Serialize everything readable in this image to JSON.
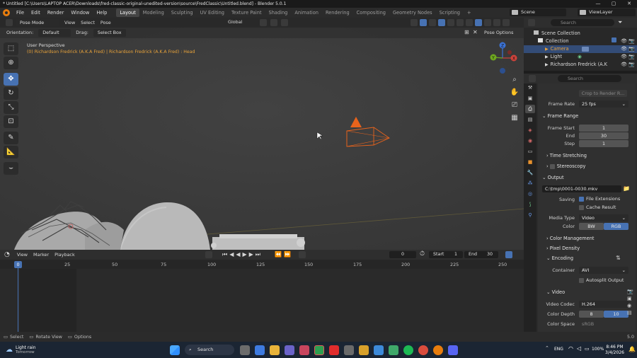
{
  "window": {
    "title": "* Untitled [C:\\Users\\LAPTOP ACER\\Downloads\\fred-classic-original-unedited-version\\source\\FredClassic\\Untitled.blend] - Blender 5.0.1",
    "controls": [
      "—",
      "▢",
      "✕"
    ]
  },
  "menu": [
    "File",
    "Edit",
    "Render",
    "Window",
    "Help"
  ],
  "workspaces": [
    "Layout",
    "Modeling",
    "Sculpting",
    "UV Editing",
    "Texture Paint",
    "Shading",
    "Animation",
    "Rendering",
    "Compositing",
    "Geometry Nodes",
    "Scripting"
  ],
  "add_workspace": "+",
  "scene": "Scene",
  "view_layer": "ViewLayer",
  "viewport": {
    "mode": "Pose Mode",
    "menus": [
      "View",
      "Select",
      "Pose"
    ],
    "transform": "Global",
    "orientation_label": "Orientation:",
    "orientation": "Default",
    "drag_label": "Drag:",
    "drag": "Select Box",
    "pose_options": "Pose Options",
    "perspective": "User Perspective",
    "object_info": "(0) Richardson Fredrick (A.K.A Fred) | Richardson Fredrick (A.K.A Fred) : Head",
    "gizmo": {
      "z": "Z",
      "y": "Y",
      "x": "X"
    }
  },
  "timeline": {
    "menus": [
      "View",
      "Marker",
      "Playback"
    ],
    "current_frame": "0",
    "start_label": "Start",
    "start": "1",
    "end_label": "End",
    "end": "30",
    "ruler": [
      "0",
      "25",
      "50",
      "75",
      "100",
      "125",
      "150",
      "175",
      "200",
      "225",
      "250"
    ]
  },
  "status": [
    "Select",
    "Rotate View",
    "Options"
  ],
  "status_right": "5.0",
  "outliner": {
    "search_placeholder": "Search",
    "rows": [
      "Scene Collection",
      "Collection",
      "Camera",
      "Light",
      "Richardson Fredrick (A.K"
    ]
  },
  "properties": {
    "search_placeholder": "Search",
    "crop_label": "Crop to Render R...",
    "frame_rate_label": "Frame Rate",
    "frame_rate": "25 fps",
    "frame_range": "Frame Range",
    "frame_start_label": "Frame Start",
    "frame_start": "1",
    "end_label": "End",
    "end": "30",
    "step_label": "Step",
    "step": "1",
    "time_stretching": "Time Stretching",
    "stereoscopy": "Stereoscopy",
    "output": "Output",
    "output_path": "C:\\tmp\\0001-0030.mkv",
    "saving_label": "Saving",
    "file_extensions": "File Extensions",
    "cache_result": "Cache Result",
    "media_type_label": "Media Type",
    "media_type": "Video",
    "color_label": "Color",
    "bw": "BW",
    "rgb": "RGB",
    "color_management": "Color Management",
    "pixel_density": "Pixel Density",
    "encoding": "Encoding",
    "container_label": "Container",
    "container": "AVI",
    "autosplit": "Autosplit Output",
    "video": "Video",
    "video_codec_label": "Video Codec",
    "video_codec": "H.264",
    "color_depth_label": "Color Depth",
    "depth_8": "8",
    "depth_10": "10",
    "color_space_label": "Color Space",
    "color_space": "sRGB"
  },
  "taskbar": {
    "weather": "Light rain",
    "weather_sub": "Tomorrow",
    "search": "Search",
    "lang": "ENG",
    "battery": "100%",
    "time": "8:46 PM",
    "date": "3/4/2026"
  },
  "colors": {
    "accent": "#4772b3",
    "camera": "#e8631c",
    "selection": "#e9a33a"
  }
}
